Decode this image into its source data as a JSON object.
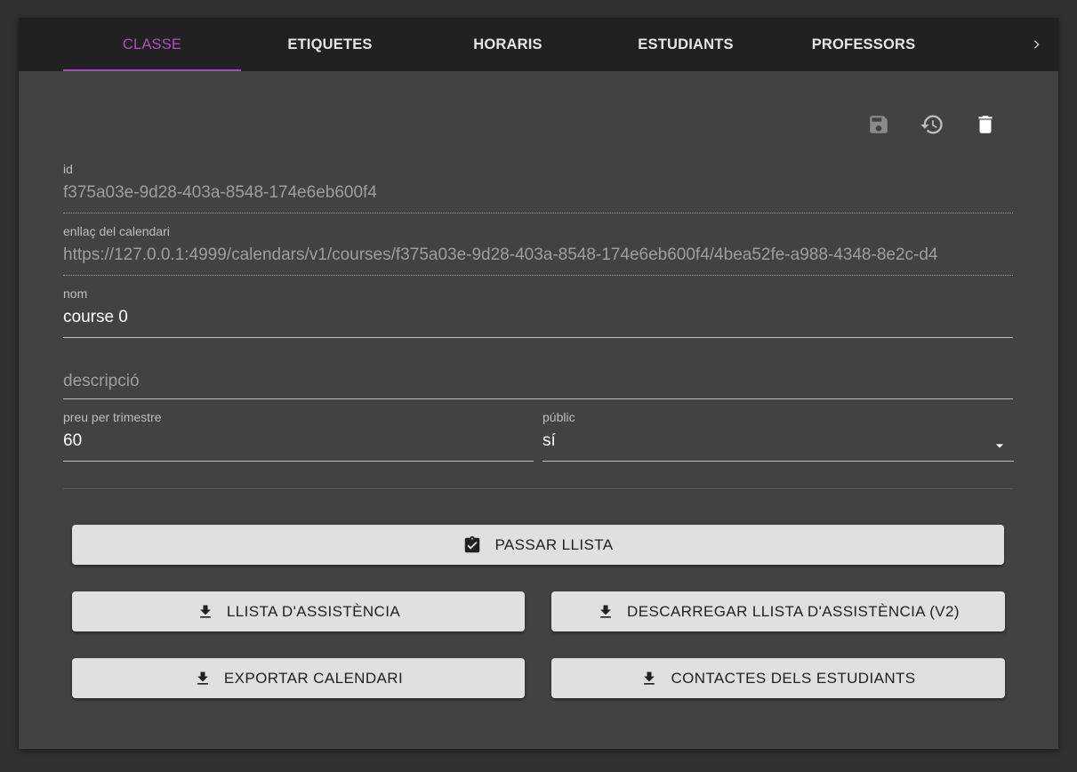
{
  "tabs": [
    {
      "label": "CLASSE",
      "active": true
    },
    {
      "label": "ETIQUETES"
    },
    {
      "label": "HORARIS"
    },
    {
      "label": "ESTUDIANTS"
    },
    {
      "label": "PROFESSORS"
    }
  ],
  "toolbar": {
    "icons": [
      "save-icon",
      "history-icon",
      "delete-icon"
    ]
  },
  "fields": {
    "id": {
      "label": "id",
      "value": "f375a03e-9d28-403a-8548-174e6eb600f4"
    },
    "calendar_link": {
      "label": "enllaç del calendari",
      "value": "https://127.0.0.1:4999/calendars/v1/courses/f375a03e-9d28-403a-8548-174e6eb600f4/4bea52fe-a988-4348-8e2c-d4"
    },
    "name": {
      "label": "nom",
      "value": "course 0"
    },
    "description": {
      "placeholder": "descripció",
      "value": ""
    },
    "price": {
      "label": "preu per trimestre",
      "value": "60"
    },
    "public": {
      "label": "públic",
      "value": "sí"
    }
  },
  "buttons": {
    "take_attendance": "PASSAR LLISTA",
    "attendance_list": "LLISTA D'ASSISTÈNCIA",
    "download_attendance_v2": "DESCARREGAR LLISTA D'ASSISTÈNCIA (V2)",
    "export_calendar": "EXPORTAR CALENDARI",
    "student_contacts": "CONTACTES DELS ESTUDIANTS"
  },
  "colors": {
    "accent": "#ab47bc",
    "card": "#424242",
    "tabbar": "#212121",
    "button": "#e0e0e0"
  }
}
